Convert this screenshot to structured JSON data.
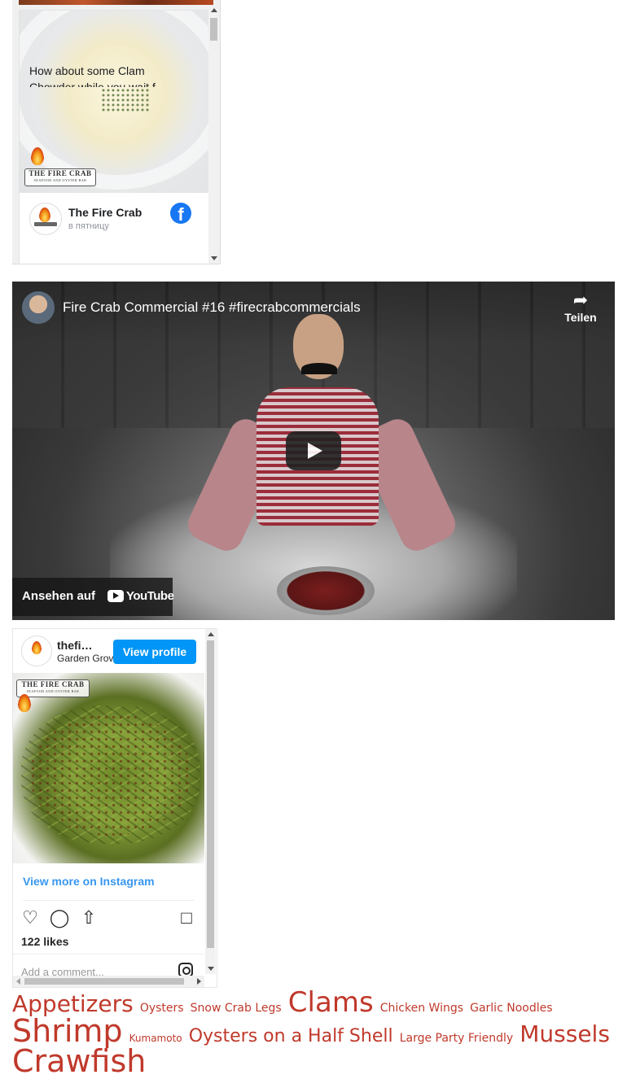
{
  "facebook": {
    "page_name": "The Fire Crab",
    "post_time": "в пятницу",
    "post_text_line1": "How about some Clam",
    "post_text_line2": "Chowder while you wait f",
    "logo_badge_line1": "THE FIRE CRAB",
    "logo_badge_line2": "SEAFOOD AND OYSTER BAR"
  },
  "video": {
    "title": "Fire Crab Commercial #16 #firecrabcommercials",
    "share_label": "Teilen",
    "watch_label": "Ansehen auf",
    "youtube_label": "YouTube"
  },
  "instagram": {
    "username": "thefi…",
    "location": "Garden Grov",
    "view_profile_label": "View profile",
    "view_more_label": "View more on Instagram",
    "likes": "122 likes",
    "comment_placeholder": "Add a comment...",
    "logo_badge_line1": "THE FIRE CRAB",
    "logo_badge_line2": "SEAFOOD AND OYSTER BAR"
  },
  "tags": [
    {
      "label": "Appetizers",
      "size": "s3"
    },
    {
      "label": "Oysters",
      "size": "s1"
    },
    {
      "label": "Snow Crab Legs",
      "size": "s1"
    },
    {
      "label": "Clams",
      "size": "s4"
    },
    {
      "label": "Chicken Wings",
      "size": "s1"
    },
    {
      "label": "Garlic Noodles",
      "size": "s1"
    },
    {
      "label": "Shrimp",
      "size": "s5"
    },
    {
      "label": "Kumamoto",
      "size": "s0"
    },
    {
      "label": "Oysters on a Half Shell",
      "size": "s2"
    },
    {
      "label": "Large Party Friendly",
      "size": "s1"
    },
    {
      "label": "Mussels",
      "size": "s3"
    },
    {
      "label": "Crawfish",
      "size": "s5"
    }
  ],
  "colors": {
    "tag_red": "#c0392b",
    "facebook_blue": "#1877f2",
    "instagram_blue": "#0095f6",
    "instagram_link": "#3897f0"
  },
  "icons": {
    "facebook": "facebook-icon",
    "share": "share-icon",
    "play": "play-icon",
    "youtube": "youtube-icon",
    "like": "heart-icon",
    "comment": "comment-icon",
    "share_ig": "share-icon",
    "save": "bookmark-icon",
    "instagram": "instagram-icon"
  }
}
